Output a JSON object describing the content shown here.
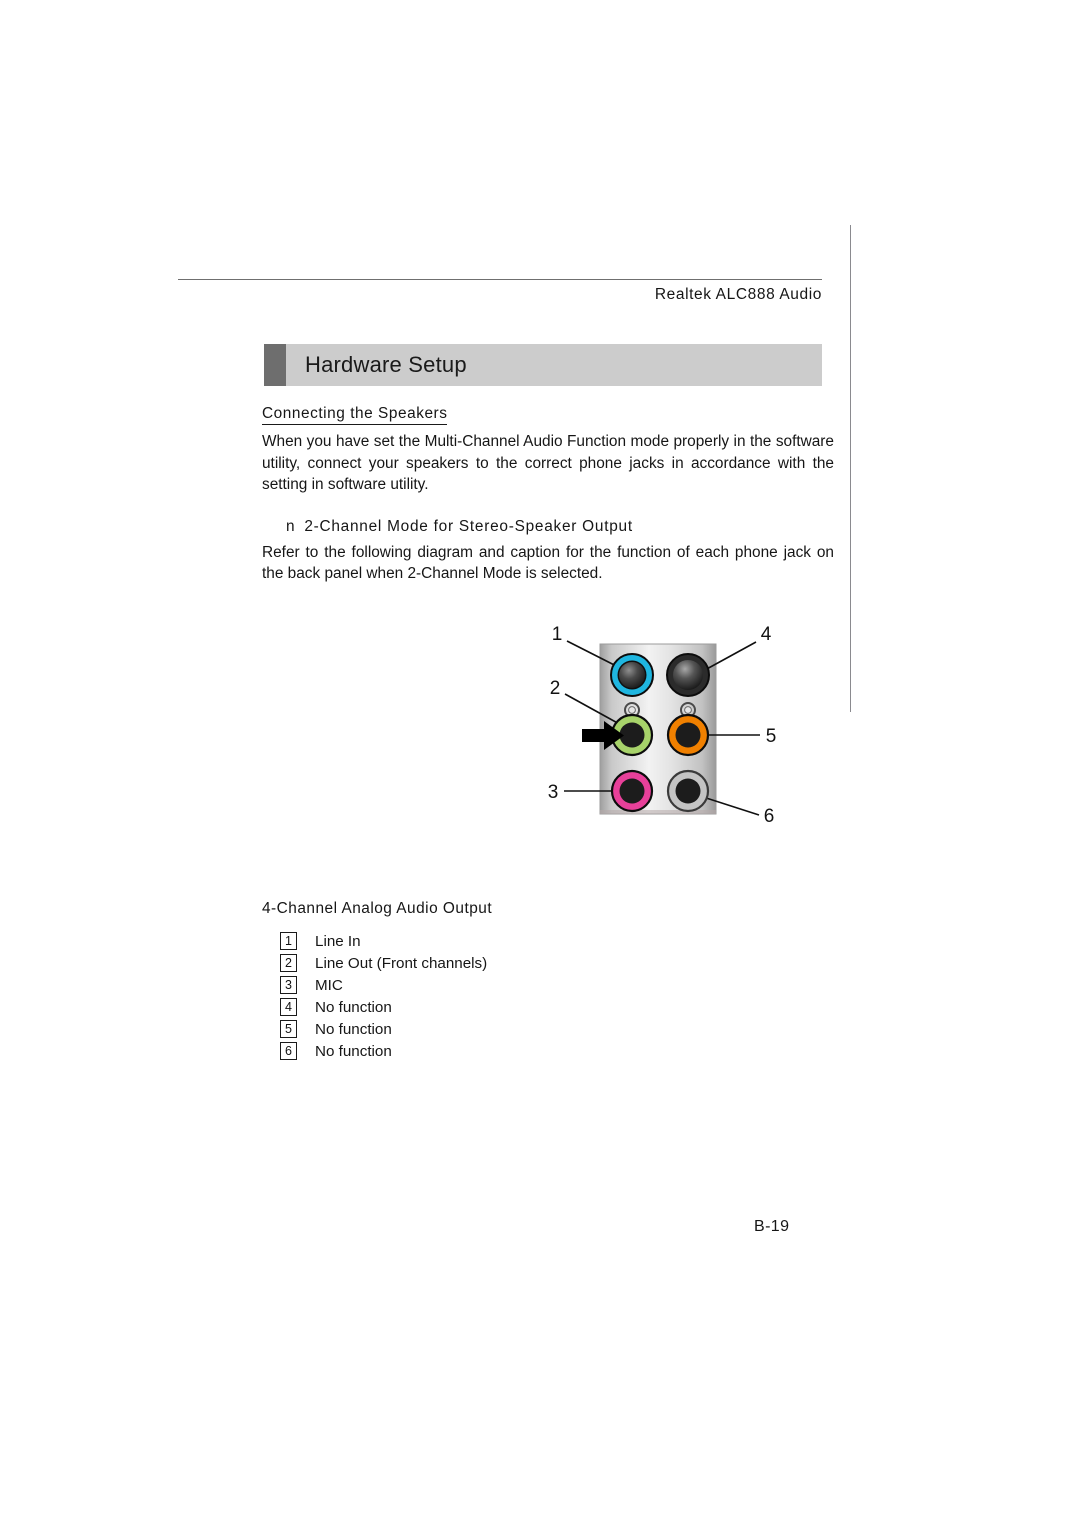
{
  "header": {
    "title": "Realtek ALC888 Audio"
  },
  "banner": {
    "title": "Hardware Setup"
  },
  "content": {
    "subhead": "Connecting the Speakers",
    "paragraph1": "When you have set the Multi-Channel Audio Function mode properly in the software utility, connect your speakers to the correct phone jacks in accordance with the setting in software utility.",
    "bullet_mark": "n",
    "bullet_title": "2-Channel Mode for Stereo-Speaker Output",
    "paragraph2": "Refer to the following diagram and caption for the function of each phone jack on the back panel when 2-Channel Mode is selected."
  },
  "diagram": {
    "labels": {
      "one": "1",
      "two": "2",
      "three": "3",
      "four": "4",
      "five": "5",
      "six": "6"
    },
    "jacks": [
      {
        "id": "1",
        "position": "top-left",
        "ring_color": "#1fb6e0",
        "center_color": "#2e2e2e"
      },
      {
        "id": "4",
        "position": "top-right",
        "ring_color": "#2b2b2b",
        "center_color": "#2e2e2e"
      },
      {
        "id": "2",
        "position": "middle-left",
        "ring_color": "#a7d36a",
        "center_color": "#222222"
      },
      {
        "id": "5",
        "position": "middle-right",
        "ring_color": "#f08000",
        "center_color": "#222222"
      },
      {
        "id": "3",
        "position": "bottom-left",
        "ring_color": "#e8409a",
        "center_color": "#222222"
      },
      {
        "id": "6",
        "position": "bottom-right",
        "ring_color": "#bfbfbf",
        "center_color": "#222222"
      }
    ],
    "panel_color": "#d9d9d9",
    "arrow_color": "#000000"
  },
  "caption": {
    "heading": "4-Channel Analog Audio Output",
    "items": [
      {
        "num": "1",
        "text": "Line In"
      },
      {
        "num": "2",
        "text": "Line Out (Front channels)"
      },
      {
        "num": "3",
        "text": "MIC"
      },
      {
        "num": "4",
        "text": "No function"
      },
      {
        "num": "5",
        "text": "No function"
      },
      {
        "num": "6",
        "text": "No function"
      }
    ]
  },
  "footer": {
    "page_number": "B-19"
  }
}
